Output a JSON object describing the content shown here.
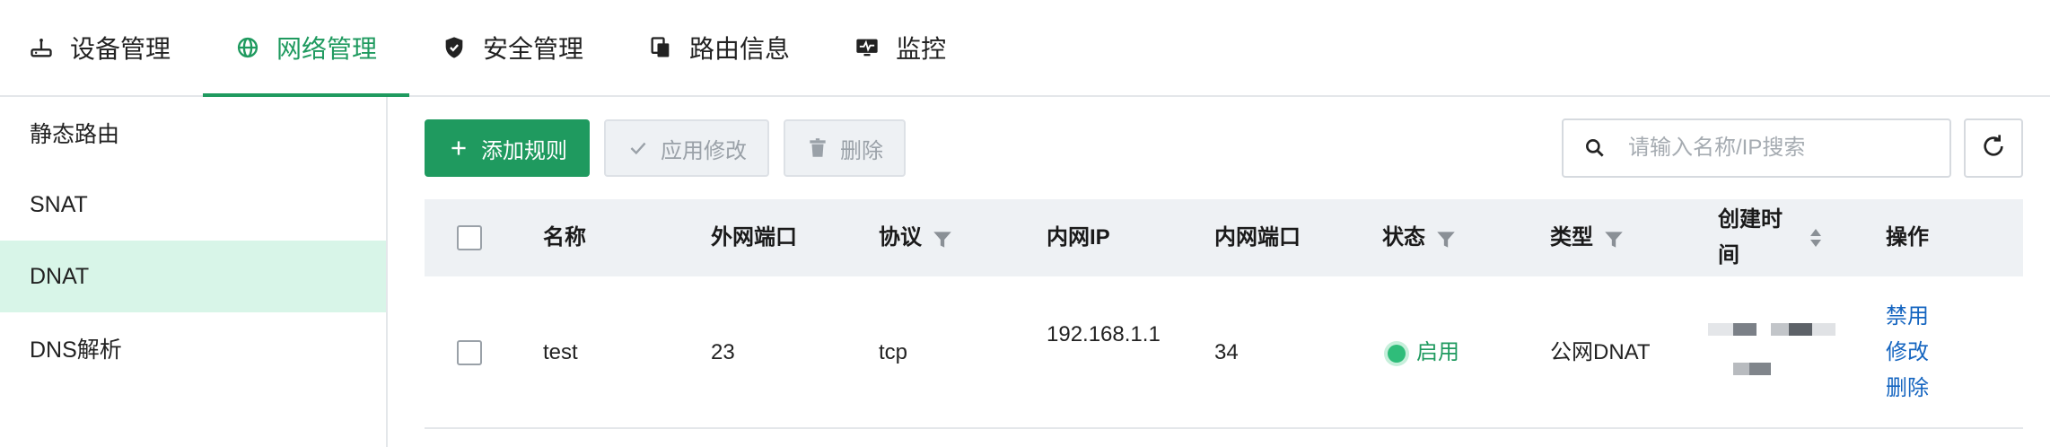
{
  "topnav": {
    "tabs": [
      {
        "label": "设备管理",
        "icon": "router-icon"
      },
      {
        "label": "网络管理",
        "icon": "globe-icon",
        "active": true
      },
      {
        "label": "安全管理",
        "icon": "shield-icon"
      },
      {
        "label": "路由信息",
        "icon": "copy-icon"
      },
      {
        "label": "监控",
        "icon": "monitor-icon"
      }
    ]
  },
  "sidebar": {
    "items": [
      {
        "label": "静态路由"
      },
      {
        "label": "SNAT"
      },
      {
        "label": "DNAT",
        "active": true
      },
      {
        "label": "DNS解析"
      }
    ]
  },
  "toolbar": {
    "add_label": "添加规则",
    "apply_label": "应用修改",
    "delete_label": "删除",
    "search_placeholder": "请输入名称/IP搜索"
  },
  "table": {
    "headers": {
      "name": "名称",
      "ext_port": "外网端口",
      "protocol": "协议",
      "int_ip": "内网IP",
      "int_port": "内网端口",
      "status": "状态",
      "type": "类型",
      "created": "创建时间",
      "actions": "操作"
    },
    "rows": [
      {
        "name": "test",
        "ext_port": "23",
        "protocol": "tcp",
        "int_ip": "192.168.1.1",
        "int_port": "34",
        "status": "启用",
        "type": "公网DNAT",
        "actions": {
          "disable": "禁用",
          "edit": "修改",
          "delete": "删除"
        }
      }
    ]
  },
  "colors": {
    "accent": "#1f9a5f",
    "link": "#1565c0",
    "status_enabled": "#2fbd7a"
  }
}
